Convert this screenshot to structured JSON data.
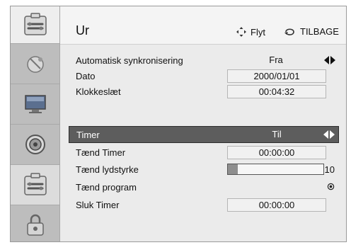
{
  "header": {
    "title": "Ur",
    "move_hint": "Flyt",
    "back_hint": "TILBAGE"
  },
  "sidebar": {
    "items": [
      {
        "icon": "tools-icon",
        "active": false
      },
      {
        "icon": "satellite-dish-icon",
        "active": false
      },
      {
        "icon": "monitor-icon",
        "active": false
      },
      {
        "icon": "speaker-icon",
        "active": false
      },
      {
        "icon": "tools-icon",
        "active": true
      },
      {
        "icon": "lock-icon",
        "active": false
      }
    ]
  },
  "settings": {
    "auto_sync": {
      "label": "Automatisk synkronisering",
      "value": "Fra"
    },
    "date": {
      "label": "Dato",
      "value": "2000/01/01"
    },
    "clock": {
      "label": "Klokkeslæt",
      "value": "00:04:32"
    },
    "timer": {
      "label": "Timer",
      "value": "Til"
    },
    "on_timer": {
      "label": "Tænd Timer",
      "value": "00:00:00"
    },
    "on_volume": {
      "label": "Tænd lydstyrke",
      "value": "10",
      "level_fraction": 0.1
    },
    "on_program": {
      "label": "Tænd program"
    },
    "off_timer": {
      "label": "Sluk Timer",
      "value": "00:00:00"
    }
  },
  "colors": {
    "selected_row": "#5d5d5d",
    "background": "#ebebeb",
    "sidebar": "#bdbdbd"
  }
}
